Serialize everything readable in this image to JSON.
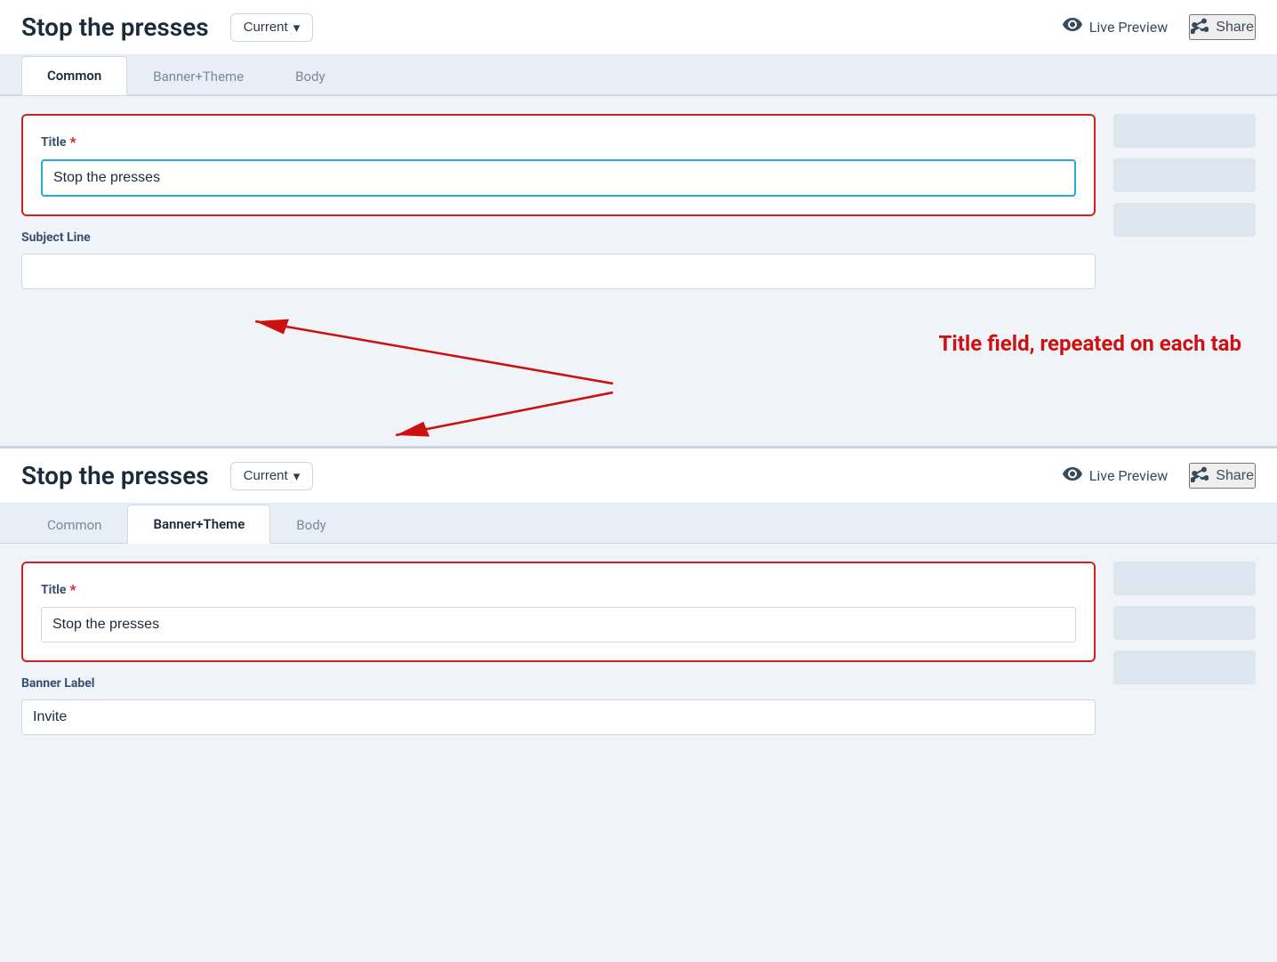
{
  "top": {
    "title": "Stop the presses",
    "version_label": "Current",
    "chevron": "▾",
    "live_preview_label": "Live Preview",
    "share_label": "Share",
    "tabs": [
      {
        "id": "common",
        "label": "Common",
        "active": true
      },
      {
        "id": "banner-theme",
        "label": "Banner+Theme",
        "active": false
      },
      {
        "id": "body",
        "label": "Body",
        "active": false
      }
    ],
    "form_card": {
      "title_label": "Title",
      "title_value": "Stop the presses",
      "title_placeholder": ""
    },
    "subject_line": {
      "label": "Subject Line",
      "value": "",
      "placeholder": ""
    }
  },
  "annotation": {
    "text": "Title field, repeated on each tab"
  },
  "bottom": {
    "title": "Stop the presses",
    "version_label": "Current",
    "chevron": "▾",
    "live_preview_label": "Live Preview",
    "share_label": "Share",
    "tabs": [
      {
        "id": "common",
        "label": "Common",
        "active": false
      },
      {
        "id": "banner-theme",
        "label": "Banner+Theme",
        "active": true
      },
      {
        "id": "body",
        "label": "Body",
        "active": false
      }
    ],
    "form_card": {
      "title_label": "Title",
      "title_value": "Stop the presses",
      "title_placeholder": ""
    },
    "banner_label_section": {
      "label": "Banner Label",
      "value": "Invite",
      "placeholder": ""
    }
  },
  "icons": {
    "eye": "◎",
    "share": "↪",
    "chevron_down": "∨"
  }
}
